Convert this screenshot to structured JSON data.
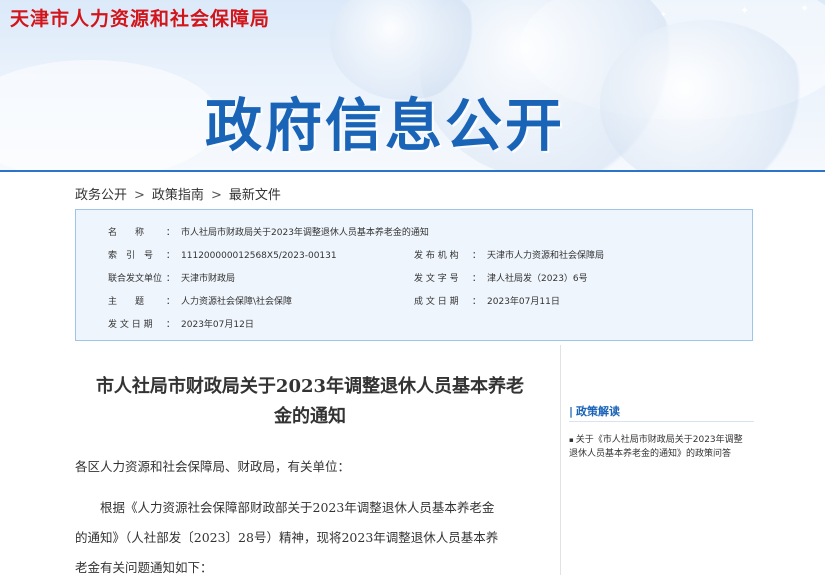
{
  "header": {
    "org_name": "天津市人力资源和社会保障局",
    "hero_title": "政府信息公开"
  },
  "breadcrumb": [
    "政务公开",
    "政策指南",
    "最新文件"
  ],
  "breadcrumb_separator": ">",
  "info": {
    "name_label": "名　　称",
    "name_value": "市人社局市财政局关于2023年调整退休人员基本养老金的通知",
    "index_label": "索　引　号",
    "index_value": "111200000012568X5/2023-00131",
    "publisher_label": "发 布 机 构",
    "publisher_value": "天津市人力资源和社会保障局",
    "joint_label": "联合发文单位",
    "joint_value": "天津市财政局",
    "docno_label": "发 文 字 号",
    "docno_value": "津人社局发（2023）6号",
    "topic_label": "主　　题",
    "topic_value": "人力资源社会保障\\社会保障",
    "created_label": "成 文 日 期",
    "created_value": "2023年07月11日",
    "issued_label": "发 文 日 期",
    "issued_value": "2023年07月12日",
    "separator": "："
  },
  "article": {
    "title_line1": "市人社局市财政局关于2023年调整退休人员基本养老",
    "title_line2": "金的通知",
    "salutation": "各区人力资源和社会保障局、财政局，有关单位：",
    "body_line1": "　　根据《人力资源社会保障部财政部关于2023年调整退休人员基本养老金",
    "body_line2": "的通知》（人社部发〔2023〕28号）精神，现将2023年调整退休人员基本养",
    "body_line3": "老金有关问题通知如下："
  },
  "sidebar": {
    "heading": "政策解读",
    "heading_prefix": "|",
    "bullet": "▪",
    "item1_line1": "关于《市人社局市财政局关于2023年调整",
    "item1_line2": "退休人员基本养老金的通知》的政策问答"
  },
  "colors": {
    "org_red": "#d1151b",
    "brand_blue": "#1a64b7",
    "infobox_bg": "#eef5fc",
    "infobox_border": "#9ec4e8"
  }
}
